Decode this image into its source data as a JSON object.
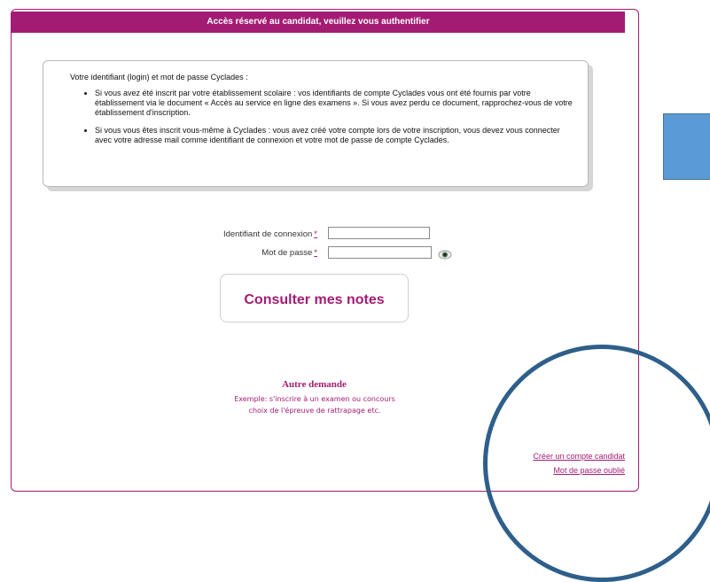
{
  "header": {
    "title": "Accès réservé au candidat, veuillez vous authentifier"
  },
  "info": {
    "intro": "Votre identifiant (login) et mot de passe Cyclades :",
    "bullets": [
      "Si vous avez été inscrit par votre établissement scolaire : vos identifiants de compte Cyclades vous ont été fournis par votre établissement via le document « Accès au service en ligne des examens ». Si vous avez perdu ce document, rapprochez-vous de votre établissement d'inscription.",
      "Si vous vous êtes inscrit vous-même à Cyclades : vous avez créé votre compte lors de votre inscription, vous devez vous connecter avec votre adresse mail comme identifiant de connexion et votre mot de passe de compte Cyclades."
    ]
  },
  "form": {
    "login_label": "Identifiant de connexion",
    "password_label": "Mot de passe",
    "required_marker": "*",
    "login_value": "",
    "password_value": ""
  },
  "submit": {
    "label": "Consulter mes notes"
  },
  "autre": {
    "title": "Autre demande",
    "line1": "Exemple: s'inscrire à un examen ou concours",
    "line2": "choix de l'épreuve de rattrapage etc."
  },
  "links": {
    "create_account": "Créer un compte candidat",
    "forgot_password": "Mot de passe oublié"
  },
  "colors": {
    "accent": "#a31c73",
    "annotation_blue": "#5b9bd5",
    "circle": "#2e5f8a"
  },
  "icons": {
    "password_toggle": "eye-icon"
  }
}
